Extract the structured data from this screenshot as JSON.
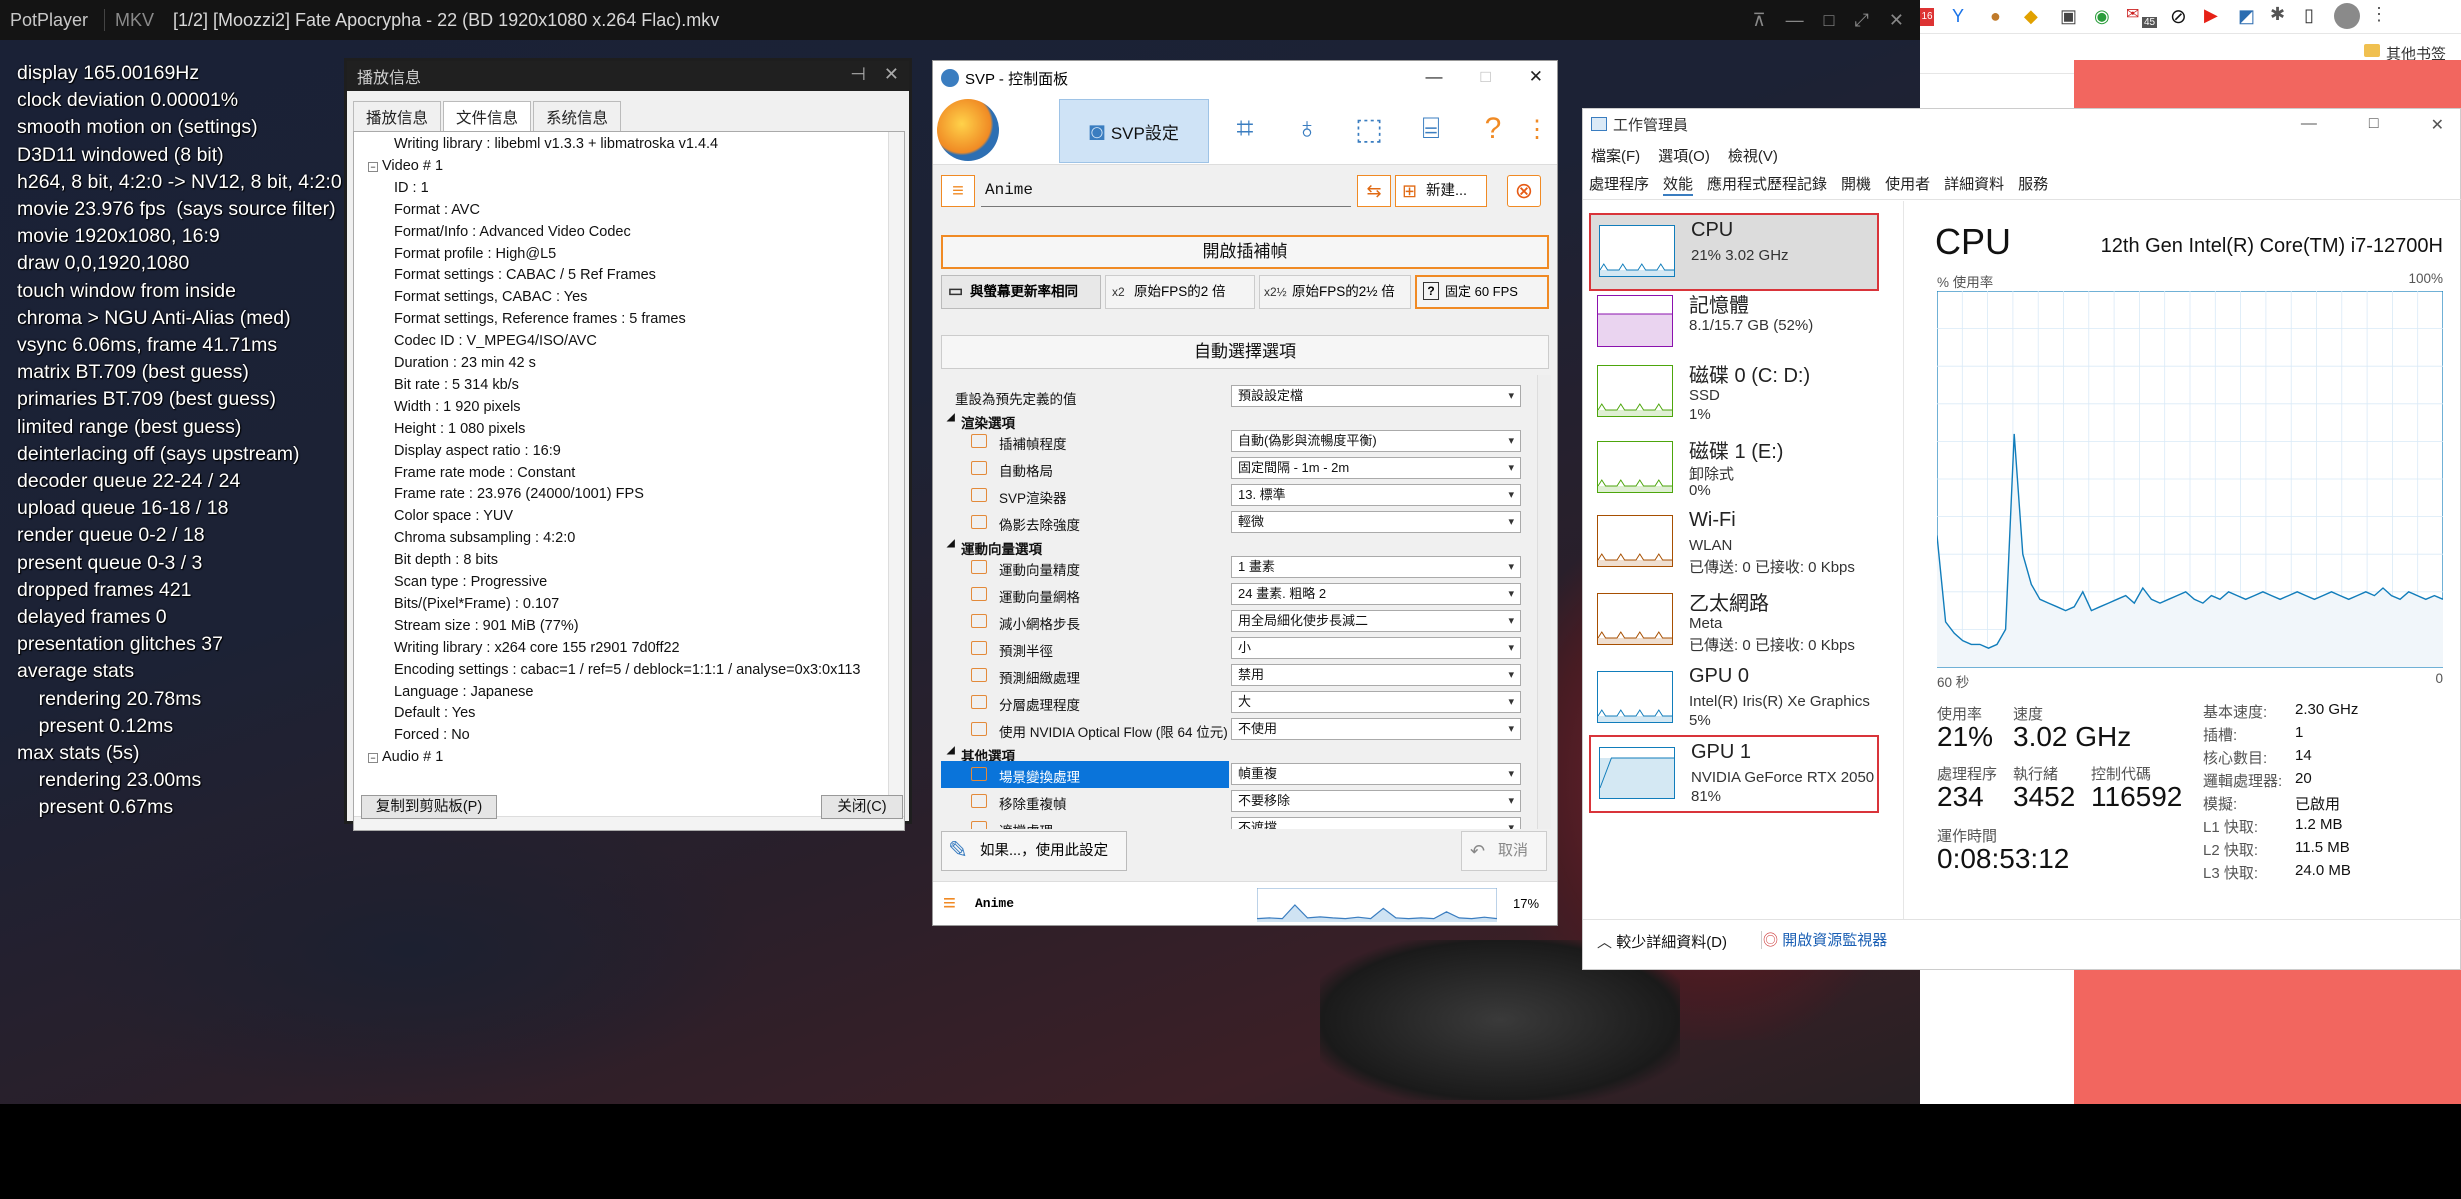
{
  "potplayer": {
    "app_name": "PotPlayer",
    "format": "MKV",
    "file_title": "[1/2] [Moozzi2] Fate Apocrypha - 22 (BD 1920x1080 x.264 Flac).mkv"
  },
  "stats_overlay": [
    "display 165.00169Hz",
    "clock deviation 0.00001%",
    "smooth motion on (settings)",
    "D3D11 windowed (8 bit)",
    "h264, 8 bit, 4:2:0 -> NV12, 8 bit, 4:2:0",
    "movie 23.976 fps  (says source filter)",
    "movie 1920x1080, 16:9",
    "draw 0,0,1920,1080",
    "touch window from inside",
    "chroma > NGU Anti-Alias (med)",
    "vsync 6.06ms, frame 41.71ms",
    "matrix BT.709 (best guess)",
    "primaries BT.709 (best guess)",
    "limited range (best guess)",
    "deinterlacing off (says upstream)",
    "decoder queue 22-24 / 24",
    "upload queue 16-18 / 18",
    "render queue 0-2 / 18",
    "present queue 0-3 / 3",
    "dropped frames 421",
    "delayed frames 0",
    "presentation glitches 37",
    "average stats",
    "    rendering 20.78ms",
    "    present 0.12ms",
    "max stats (5s)",
    "    rendering 23.00ms",
    "    present 0.67ms"
  ],
  "playinfo": {
    "title": "播放信息",
    "tabs": [
      "播放信息",
      "文件信息",
      "系统信息"
    ],
    "lines": [
      "Writing library : libebml v1.3.3 + libmatroska v1.4.4",
      "Video # 1",
      "ID : 1",
      "Format : AVC",
      "Format/Info : Advanced Video Codec",
      "Format profile : High@L5",
      "Format settings : CABAC / 5 Ref Frames",
      "Format settings, CABAC : Yes",
      "Format settings, Reference frames : 5 frames",
      "Codec ID : V_MPEG4/ISO/AVC",
      "Duration : 23 min 42 s",
      "Bit rate : 5 314 kb/s",
      "Width : 1 920 pixels",
      "Height : 1 080 pixels",
      "Display aspect ratio : 16:9",
      "Frame rate mode : Constant",
      "Frame rate : 23.976 (24000/1001) FPS",
      "Color space : YUV",
      "Chroma subsampling : 4:2:0",
      "Bit depth : 8 bits",
      "Scan type : Progressive",
      "Bits/(Pixel*Frame) : 0.107",
      "Stream size : 901 MiB (77%)",
      "Writing library : x264 core 155 r2901 7d0ff22",
      "Encoding settings : cabac=1 / ref=5 / deblock=1:1:1 / analyse=0x3:0x113",
      "Language : Japanese",
      "Default : Yes",
      "Forced : No",
      "Audio # 1"
    ],
    "copy_button": "复制到剪贴板(P)",
    "close_button": "关闭(C)"
  },
  "svp": {
    "title": "SVP - 控制面板",
    "tab_label": "SVP設定",
    "profile_name": "Anime",
    "new_button": "新建...",
    "enable_button": "開啟插補幀",
    "rate_options": [
      "與螢幕更新率相同",
      "原始FPS的2 倍",
      "原始FPS的2½ 倍",
      "固定 60 FPS"
    ],
    "rate_icons": [
      "x2",
      "x2½",
      "?"
    ],
    "auto_select": "自動選擇選項",
    "rows": [
      {
        "kind": "row",
        "label": "重設為預先定義的值",
        "value": "預設設定檔",
        "indent": false
      },
      {
        "kind": "section",
        "label": "渲染選項"
      },
      {
        "kind": "row",
        "label": "插補幀程度",
        "value": "自動(偽影與流暢度平衡)",
        "indent": true
      },
      {
        "kind": "row",
        "label": "自動格局",
        "value": "固定間隔 - 1m - 2m",
        "indent": true
      },
      {
        "kind": "row",
        "label": "SVP渲染器",
        "value": "13. 標準",
        "indent": true
      },
      {
        "kind": "row",
        "label": "偽影去除強度",
        "value": "輕微",
        "indent": true
      },
      {
        "kind": "section",
        "label": "運動向量選項"
      },
      {
        "kind": "row",
        "label": "運動向量精度",
        "value": "1 畫素",
        "indent": true
      },
      {
        "kind": "row",
        "label": "運動向量網格",
        "value": "24 畫素. 粗略 2",
        "indent": true
      },
      {
        "kind": "row",
        "label": "減小網格步長",
        "value": "用全局細化使步長減二",
        "indent": true
      },
      {
        "kind": "row",
        "label": "預測半徑",
        "value": "小",
        "indent": true
      },
      {
        "kind": "row",
        "label": "預測細緻處理",
        "value": "禁用",
        "indent": true
      },
      {
        "kind": "row",
        "label": "分層處理程度",
        "value": "大",
        "indent": true
      },
      {
        "kind": "row",
        "label": "使用 NVIDIA Optical Flow (限 64 位元)",
        "value": "不使用",
        "indent": true
      },
      {
        "kind": "section",
        "label": "其他選項"
      },
      {
        "kind": "row",
        "label": "場景變換處理",
        "value": "幀重複",
        "indent": true,
        "selected": true
      },
      {
        "kind": "row",
        "label": "移除重複幀",
        "value": "不要移除",
        "indent": true
      },
      {
        "kind": "row",
        "label": "遮擋處理",
        "value": "不遮擋",
        "indent": true
      }
    ],
    "if_button": "如果...，使用此設定",
    "cancel_button": "取消",
    "status_profile": "Anime",
    "status_percent": "17%",
    "status_graph": [
      0.1,
      0.12,
      0.1,
      0.5,
      0.12,
      0.15,
      0.12,
      0.1,
      0.14,
      0.1,
      0.4,
      0.12,
      0.1,
      0.12,
      0.1,
      0.3,
      0.12,
      0.1,
      0.14,
      0.1
    ]
  },
  "taskmgr": {
    "title": "工作管理員",
    "menu": [
      "檔案(F)",
      "選項(O)",
      "檢視(V)"
    ],
    "tabs": [
      "處理程序",
      "效能",
      "應用程式歷程記錄",
      "開機",
      "使用者",
      "詳細資料",
      "服務"
    ],
    "perf_items": [
      {
        "name": "CPU",
        "sub1": "21% 3.02 GHz",
        "sub2": "",
        "color": "#117dbb",
        "selected": true,
        "highlight": true
      },
      {
        "name": "記憶體",
        "sub1": "8.1/15.7 GB (52%)",
        "sub2": "",
        "color": "#8b12ae",
        "selected": false,
        "highlight": false
      },
      {
        "name": "磁碟 0 (C: D:)",
        "sub1": "SSD",
        "sub2": "1%",
        "color": "#4da60c",
        "selected": false,
        "highlight": false
      },
      {
        "name": "磁碟 1 (E:)",
        "sub1": "卸除式",
        "sub2": "0%",
        "color": "#4da60c",
        "selected": false,
        "highlight": false
      },
      {
        "name": "Wi-Fi",
        "sub1": "WLAN",
        "sub2": "已傳送: 0 已接收: 0 Kbps",
        "color": "#a74f01",
        "selected": false,
        "highlight": false
      },
      {
        "name": "乙太網路",
        "sub1": "Meta",
        "sub2": "已傳送: 0 已接收: 0 Kbps",
        "color": "#a74f01",
        "selected": false,
        "highlight": false
      },
      {
        "name": "GPU 0",
        "sub1": "Intel(R) Iris(R) Xe Graphics",
        "sub2": "5%",
        "color": "#117dbb",
        "selected": false,
        "highlight": false
      },
      {
        "name": "GPU 1",
        "sub1": "NVIDIA GeForce RTX 2050",
        "sub2": "81%",
        "color": "#117dbb",
        "selected": false,
        "highlight": true
      }
    ],
    "cpu_title": "CPU",
    "cpu_model": "12th Gen Intel(R) Core(TM) i7-12700H",
    "graph_label": "% 使用率",
    "graph_max": "100%",
    "graph_time": "60 秒",
    "graph_min": "0",
    "cpu_usage_series": [
      35,
      12,
      9,
      7,
      6,
      6,
      5,
      6,
      10,
      62,
      30,
      22,
      18,
      17,
      16,
      15,
      16,
      20,
      15,
      16,
      17,
      18,
      19,
      17,
      21,
      18,
      17,
      18,
      19,
      20,
      18,
      17,
      19,
      18,
      20,
      19,
      18,
      19,
      20,
      19,
      18,
      19,
      20,
      19,
      18,
      19,
      20,
      19,
      18,
      19,
      20,
      19,
      21,
      19,
      18,
      20,
      19,
      18,
      19,
      18
    ],
    "usage_label": "使用率",
    "usage_value": "21%",
    "speed_label": "速度",
    "speed_value": "3.02 GHz",
    "proc_label": "處理程序",
    "proc_value": "234",
    "threads_label": "執行緒",
    "threads_value": "3452",
    "handles_label": "控制代碼",
    "handles_value": "116592",
    "uptime_label": "運作時間",
    "uptime_value": "0:08:53:12",
    "specs": [
      {
        "k": "基本速度:",
        "v": "2.30 GHz"
      },
      {
        "k": "插槽:",
        "v": "1"
      },
      {
        "k": "核心數目:",
        "v": "14"
      },
      {
        "k": "邏輯處理器:",
        "v": "20"
      },
      {
        "k": "模擬:",
        "v": "已啟用"
      },
      {
        "k": "L1 快取:",
        "v": "1.2 MB"
      },
      {
        "k": "L2 快取:",
        "v": "11.5 MB"
      },
      {
        "k": "L3 快取:",
        "v": "24.0 MB"
      }
    ],
    "fewer_details": "較少詳細資料(D)",
    "open_monitor": "開啟資源監視器"
  },
  "browser": {
    "bookmark_folder": "其他书签",
    "badge_count": "45",
    "badge_count_2": "16",
    "accent": "#f2665f"
  }
}
